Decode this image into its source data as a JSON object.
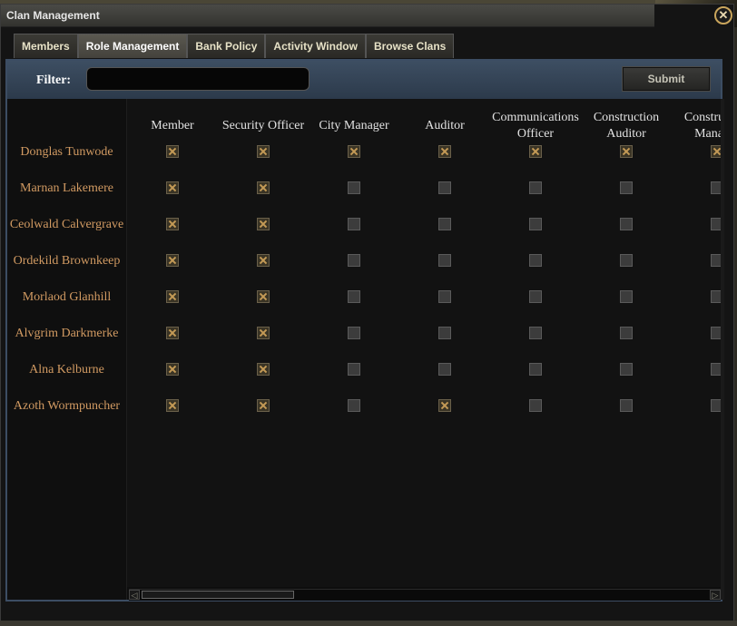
{
  "window": {
    "title": "Clan Management",
    "close_glyph": "✕"
  },
  "tabs": [
    {
      "label": "Members",
      "active": false
    },
    {
      "label": "Role Management",
      "active": true
    },
    {
      "label": "Bank Policy",
      "active": false
    },
    {
      "label": "Activity Window",
      "active": false
    },
    {
      "label": "Browse Clans",
      "active": false
    }
  ],
  "filter": {
    "label": "Filter:",
    "value": "",
    "placeholder": ""
  },
  "submit_label": "Submit",
  "columns": [
    "Member",
    "Security Officer",
    "City Manager",
    "Auditor",
    "Communications Officer",
    "Construction Auditor",
    "Construction Manager"
  ],
  "rows": [
    {
      "name": "Donglas Tunwode",
      "roles": [
        true,
        true,
        true,
        true,
        true,
        true,
        true
      ]
    },
    {
      "name": "Marnan Lakemere",
      "roles": [
        true,
        true,
        false,
        false,
        false,
        false,
        false
      ]
    },
    {
      "name": "Ceolwald Calvergrave",
      "roles": [
        true,
        true,
        false,
        false,
        false,
        false,
        false
      ]
    },
    {
      "name": "Ordekild Brownkeep",
      "roles": [
        true,
        true,
        false,
        false,
        false,
        false,
        false
      ]
    },
    {
      "name": "Morlaod Glanhill",
      "roles": [
        true,
        true,
        false,
        false,
        false,
        false,
        false
      ]
    },
    {
      "name": "Alvgrim Darkmerke",
      "roles": [
        true,
        true,
        false,
        false,
        false,
        false,
        false
      ]
    },
    {
      "name": "Alna Kelburne",
      "roles": [
        true,
        true,
        false,
        false,
        false,
        false,
        false
      ]
    },
    {
      "name": "Azoth Wormpuncher",
      "roles": [
        true,
        true,
        false,
        true,
        false,
        false,
        false
      ]
    }
  ],
  "scrollbar": {
    "left_glyph": "◁",
    "right_glyph": "▷"
  },
  "icons": {
    "close": "close-icon",
    "checkbox": "checkbox"
  },
  "colors": {
    "name_text": "#d19a62",
    "check_mark": "#c49a56",
    "filter_bar": "#3d4e62"
  }
}
